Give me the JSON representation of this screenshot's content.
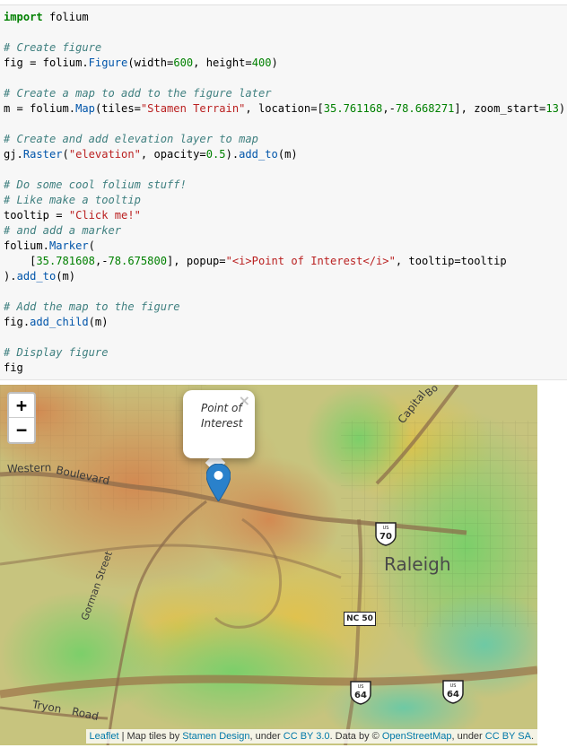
{
  "code": {
    "l1_kw": "import",
    "l1_mod": " folium",
    "l3": "# Create figure",
    "l4_a": "fig = folium.",
    "l4_fn": "Figure",
    "l4_b": "(width=",
    "l4_n1": "600",
    "l4_c": ", height=",
    "l4_n2": "400",
    "l4_d": ")",
    "l6": "# Create a map to add to the figure later",
    "l7_a": "m = folium.",
    "l7_fn": "Map",
    "l7_b": "(tiles=",
    "l7_s": "\"Stamen Terrain\"",
    "l7_c": ", location=[",
    "l7_n1": "35.761168",
    "l7_d": ",-",
    "l7_n2": "78.668271",
    "l7_e": "], zoom_start=",
    "l7_n3": "13",
    "l7_f": ")",
    "l9": "# Create and add elevation layer to map",
    "l10_a": "gj.",
    "l10_fn": "Raster",
    "l10_b": "(",
    "l10_s": "\"elevation\"",
    "l10_c": ", opacity=",
    "l10_n": "0.5",
    "l10_d": ").",
    "l10_fn2": "add_to",
    "l10_e": "(m)",
    "l12": "# Do some cool folium stuff!",
    "l13": "# Like make a tooltip",
    "l14_a": "tooltip = ",
    "l14_s": "\"Click me!\"",
    "l15": "# and add a marker",
    "l16_a": "folium.",
    "l16_fn": "Marker",
    "l16_b": "(",
    "l17_a": "    [",
    "l17_n1": "35.781608",
    "l17_b": ",-",
    "l17_n2": "78.675800",
    "l17_c": "], popup=",
    "l17_s": "\"<i>Point of Interest</i>\"",
    "l17_d": ", tooltip=tooltip",
    "l18_a": ").",
    "l18_fn": "add_to",
    "l18_b": "(m)",
    "l20": "# Add the map to the figure",
    "l21_a": "fig.",
    "l21_fn": "add_child",
    "l21_b": "(m)",
    "l23": "# Display figure",
    "l24": "fig"
  },
  "map": {
    "zoom_in": "+",
    "zoom_out": "−",
    "popup_text": "Point of Interest",
    "popup_close": "×",
    "labels": {
      "western": "Western",
      "boulevard": "Boulevard",
      "capital": "Capital",
      "bo": "Bo",
      "raleigh": "Raleigh",
      "gorman": "Gorman Street",
      "tryon": "Tryon",
      "road": "Road"
    },
    "shields": {
      "us70": "70",
      "nc50": "NC 50",
      "us64a": "64",
      "us64b": "64",
      "us": "US"
    },
    "attribution": {
      "leaflet": "Leaflet",
      "t1": " | Map tiles by ",
      "stamen": "Stamen Design",
      "t2": ", under ",
      "ccby": "CC BY 3.0",
      "t3": ". Data by © ",
      "osm": "OpenStreetMap",
      "t4": ", under ",
      "ccbysa": "CC BY SA",
      "t5": "."
    }
  }
}
